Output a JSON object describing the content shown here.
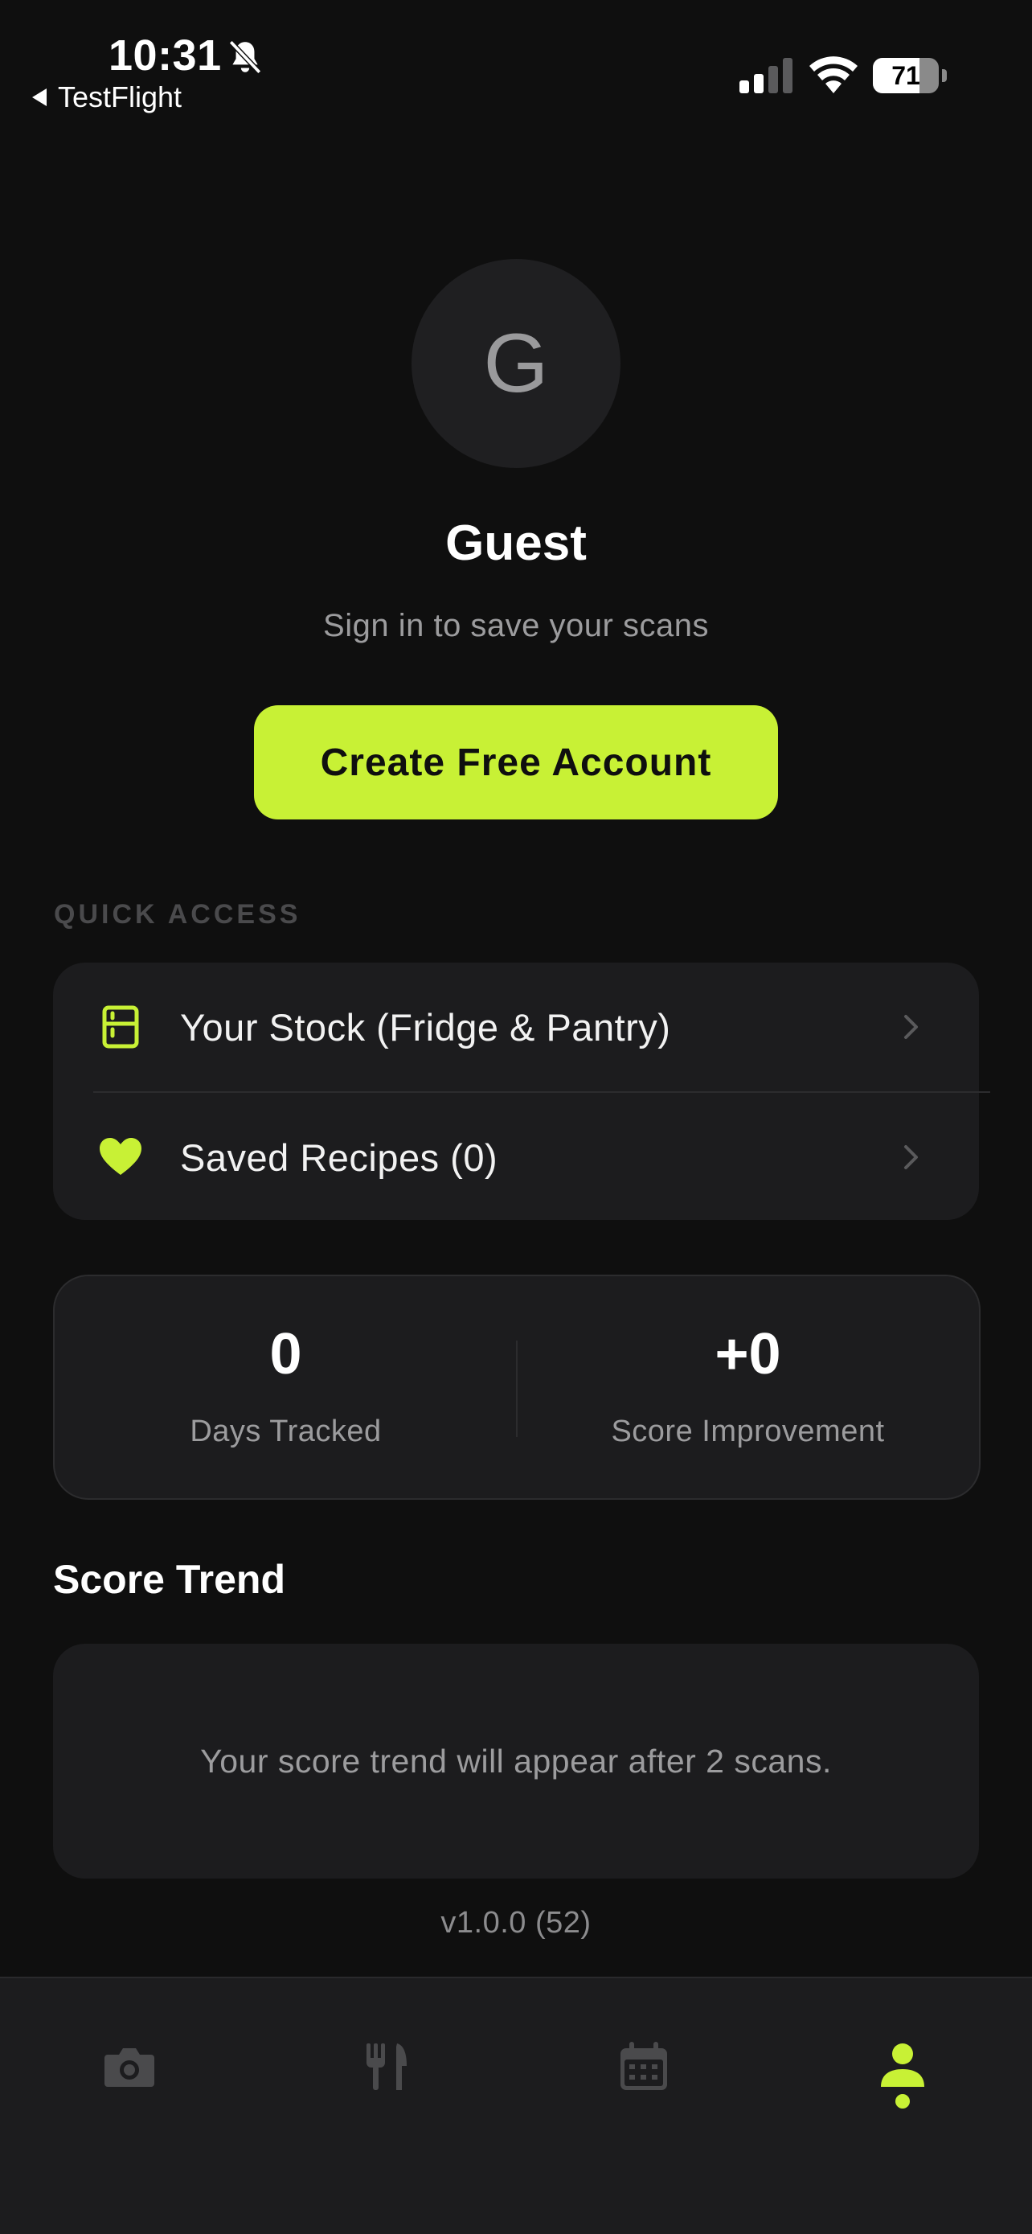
{
  "status_bar": {
    "time": "10:31",
    "back_app": "TestFlight",
    "battery": "71",
    "battery_level": 0.71
  },
  "profile": {
    "avatar_initial": "G",
    "name": "Guest",
    "subtitle": "Sign in to save your scans",
    "cta_label": "Create Free Account"
  },
  "quick_access": {
    "label": "QUICK ACCESS",
    "items": [
      {
        "label": "Your Stock (Fridge & Pantry)",
        "icon": "fridge-icon"
      },
      {
        "label": "Saved Recipes (0)",
        "icon": "heart-icon"
      }
    ]
  },
  "stats": [
    {
      "value": "0",
      "label": "Days Tracked"
    },
    {
      "value": "+0",
      "label": "Score Improvement"
    }
  ],
  "score_trend": {
    "title": "Score Trend",
    "empty_message": "Your score trend will appear after 2 scans."
  },
  "version": "v1.0.0 (52)",
  "tab_bar": {
    "tabs": [
      {
        "icon": "camera-icon",
        "active": false
      },
      {
        "icon": "utensils-icon",
        "active": false
      },
      {
        "icon": "calendar-icon",
        "active": false
      },
      {
        "icon": "person-icon",
        "active": true
      }
    ]
  },
  "colors": {
    "accent": "#c8f135",
    "background": "#0f0f0f",
    "card": "#1c1c1e",
    "inactive_icon": "#4a4a4c"
  }
}
